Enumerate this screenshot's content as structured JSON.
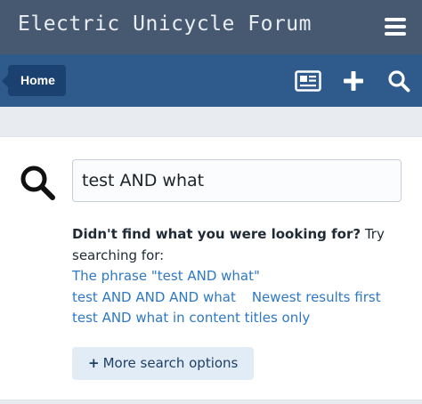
{
  "header": {
    "site_title": "Electric Unicycle Forum",
    "menu_icon": "hamburger-menu-icon"
  },
  "nav": {
    "home_label": "Home",
    "icons": [
      "whats-new-icon",
      "plus-icon",
      "search-icon"
    ]
  },
  "search": {
    "query_value": "test AND what",
    "icon": "magnifier-icon"
  },
  "suggestions": {
    "prompt_bold": "Didn't find what you were looking for?",
    "prompt_rest": " Try searching for:",
    "phrase_link": "The phrase \"test AND what\"",
    "and_link": "test AND AND AND what",
    "newest_link": "Newest results first",
    "titles_link": "test AND what in content titles only"
  },
  "actions": {
    "more_search_options_plus": "+",
    "more_search_options": "More search options"
  },
  "colors": {
    "topbar": "#475971",
    "navbar": "#2e5a8c",
    "home_tab": "#1b4170",
    "link": "#2f78c4",
    "button_bg": "#e1ecf7"
  }
}
